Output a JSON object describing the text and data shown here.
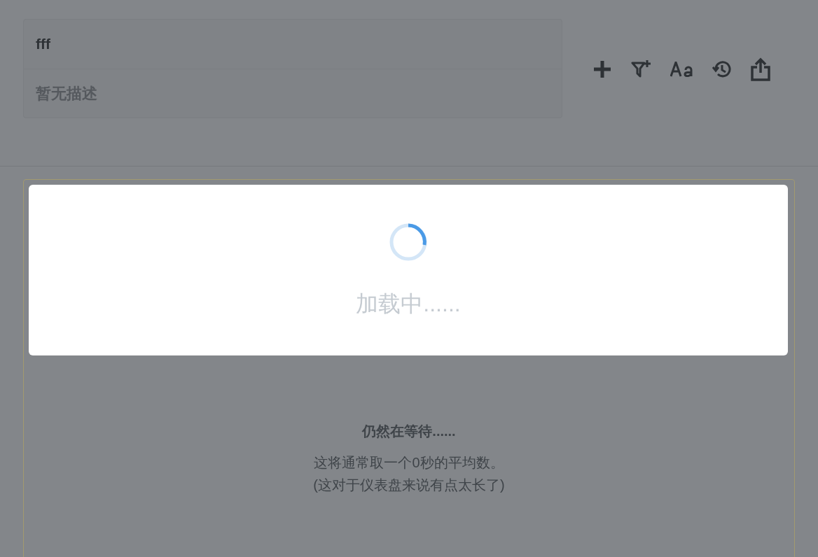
{
  "dashboard": {
    "title": "fff",
    "description": "暂无描述"
  },
  "loading": {
    "text": "加载中......"
  },
  "waiting": {
    "title": "仍然在等待......",
    "lines": [
      "这将通常取一个0秒的平均数。",
      "(这对于仪表盘来说有点太长了)"
    ]
  }
}
